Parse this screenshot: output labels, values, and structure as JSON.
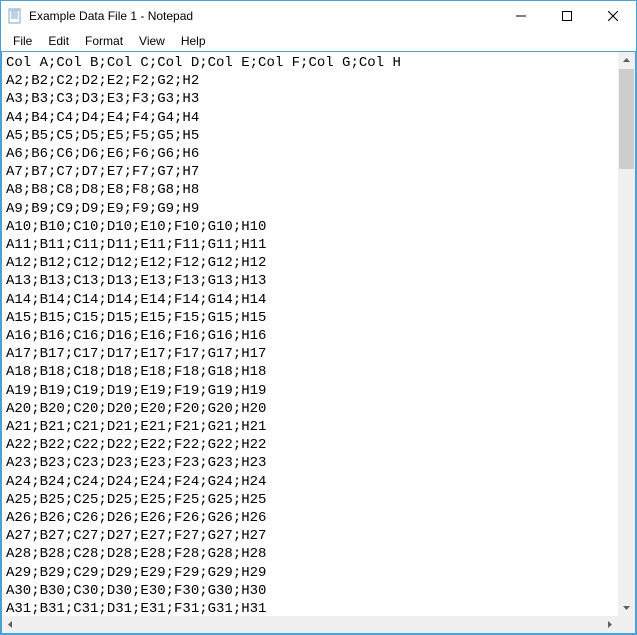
{
  "window": {
    "title": "Example Data File 1 - Notepad"
  },
  "menu": {
    "file": "File",
    "edit": "Edit",
    "format": "Format",
    "view": "View",
    "help": "Help"
  },
  "document": {
    "separator": ";",
    "header": [
      "Col A",
      "Col B",
      "Col C",
      "Col D",
      "Col E",
      "Col F",
      "Col G",
      "Col H"
    ],
    "rows": [
      [
        "A2",
        "B2",
        "C2",
        "D2",
        "E2",
        "F2",
        "G2",
        "H2"
      ],
      [
        "A3",
        "B3",
        "C3",
        "D3",
        "E3",
        "F3",
        "G3",
        "H3"
      ],
      [
        "A4",
        "B4",
        "C4",
        "D4",
        "E4",
        "F4",
        "G4",
        "H4"
      ],
      [
        "A5",
        "B5",
        "C5",
        "D5",
        "E5",
        "F5",
        "G5",
        "H5"
      ],
      [
        "A6",
        "B6",
        "C6",
        "D6",
        "E6",
        "F6",
        "G6",
        "H6"
      ],
      [
        "A7",
        "B7",
        "C7",
        "D7",
        "E7",
        "F7",
        "G7",
        "H7"
      ],
      [
        "A8",
        "B8",
        "C8",
        "D8",
        "E8",
        "F8",
        "G8",
        "H8"
      ],
      [
        "A9",
        "B9",
        "C9",
        "D9",
        "E9",
        "F9",
        "G9",
        "H9"
      ],
      [
        "A10",
        "B10",
        "C10",
        "D10",
        "E10",
        "F10",
        "G10",
        "H10"
      ],
      [
        "A11",
        "B11",
        "C11",
        "D11",
        "E11",
        "F11",
        "G11",
        "H11"
      ],
      [
        "A12",
        "B12",
        "C12",
        "D12",
        "E12",
        "F12",
        "G12",
        "H12"
      ],
      [
        "A13",
        "B13",
        "C13",
        "D13",
        "E13",
        "F13",
        "G13",
        "H13"
      ],
      [
        "A14",
        "B14",
        "C14",
        "D14",
        "E14",
        "F14",
        "G14",
        "H14"
      ],
      [
        "A15",
        "B15",
        "C15",
        "D15",
        "E15",
        "F15",
        "G15",
        "H15"
      ],
      [
        "A16",
        "B16",
        "C16",
        "D16",
        "E16",
        "F16",
        "G16",
        "H16"
      ],
      [
        "A17",
        "B17",
        "C17",
        "D17",
        "E17",
        "F17",
        "G17",
        "H17"
      ],
      [
        "A18",
        "B18",
        "C18",
        "D18",
        "E18",
        "F18",
        "G18",
        "H18"
      ],
      [
        "A19",
        "B19",
        "C19",
        "D19",
        "E19",
        "F19",
        "G19",
        "H19"
      ],
      [
        "A20",
        "B20",
        "C20",
        "D20",
        "E20",
        "F20",
        "G20",
        "H20"
      ],
      [
        "A21",
        "B21",
        "C21",
        "D21",
        "E21",
        "F21",
        "G21",
        "H21"
      ],
      [
        "A22",
        "B22",
        "C22",
        "D22",
        "E22",
        "F22",
        "G22",
        "H22"
      ],
      [
        "A23",
        "B23",
        "C23",
        "D23",
        "E23",
        "F23",
        "G23",
        "H23"
      ],
      [
        "A24",
        "B24",
        "C24",
        "D24",
        "E24",
        "F24",
        "G24",
        "H24"
      ],
      [
        "A25",
        "B25",
        "C25",
        "D25",
        "E25",
        "F25",
        "G25",
        "H25"
      ],
      [
        "A26",
        "B26",
        "C26",
        "D26",
        "E26",
        "F26",
        "G26",
        "H26"
      ],
      [
        "A27",
        "B27",
        "C27",
        "D27",
        "E27",
        "F27",
        "G27",
        "H27"
      ],
      [
        "A28",
        "B28",
        "C28",
        "D28",
        "E28",
        "F28",
        "G28",
        "H28"
      ],
      [
        "A29",
        "B29",
        "C29",
        "D29",
        "E29",
        "F29",
        "G29",
        "H29"
      ],
      [
        "A30",
        "B30",
        "C30",
        "D30",
        "E30",
        "F30",
        "G30",
        "H30"
      ],
      [
        "A31",
        "B31",
        "C31",
        "D31",
        "E31",
        "F31",
        "G31",
        "H31"
      ]
    ]
  }
}
